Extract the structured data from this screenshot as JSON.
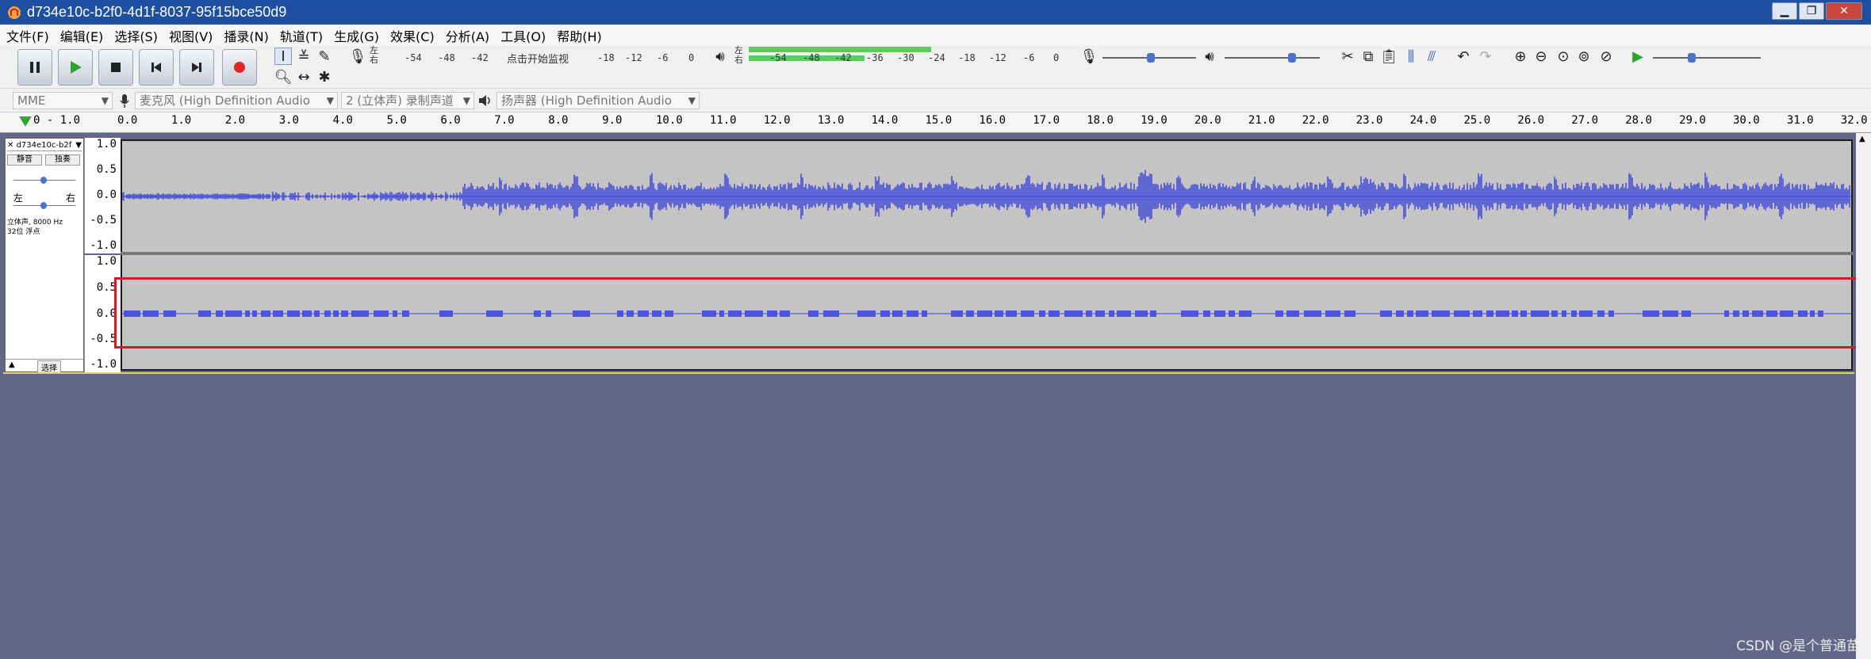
{
  "window": {
    "title": "d734e10c-b2f0-4d1f-8037-95f15bce50d9"
  },
  "menu": [
    "文件(F)",
    "编辑(E)",
    "选择(S)",
    "视图(V)",
    "播录(N)",
    "轨道(T)",
    "生成(G)",
    "效果(C)",
    "分析(A)",
    "工具(O)",
    "帮助(H)"
  ],
  "meters": {
    "record_lr": "左\n右",
    "record_ticks": [
      "-54",
      "-48",
      "-42"
    ],
    "record_hint": "点击开始监视",
    "record_ticks2": [
      "-18",
      "-12",
      "-6",
      "0"
    ],
    "play_lr": "左\n右",
    "play_ticks": [
      "-54",
      "-48",
      "-42",
      "-36",
      "-30",
      "-24",
      "-18",
      "-12",
      "-6",
      "0"
    ]
  },
  "devices": {
    "host": "MME",
    "mic": "麦克风 (High Definition Audio",
    "channels": "2 (立体声) 录制声道",
    "speaker": "扬声器 (High Definition Audio"
  },
  "ruler": {
    "first": "0 - 1.0",
    "ticks": [
      "0.0",
      "1.0",
      "2.0",
      "3.0",
      "4.0",
      "5.0",
      "6.0",
      "7.0",
      "8.0",
      "9.0",
      "10.0",
      "11.0",
      "12.0",
      "13.0",
      "14.0",
      "15.0",
      "16.0",
      "17.0",
      "18.0",
      "19.0",
      "20.0",
      "21.0",
      "22.0",
      "23.0",
      "24.0",
      "25.0",
      "26.0",
      "27.0",
      "28.0",
      "29.0",
      "30.0",
      "31.0",
      "32.0"
    ]
  },
  "track": {
    "name": "d734e10c-b2f",
    "mute": "静音",
    "solo": "独奏",
    "left": "左",
    "right": "右",
    "info_line1": "立体声, 8000 Hz",
    "info_line2": "32位 浮点",
    "select": "选择",
    "scale": [
      "1.0",
      "0.5",
      "0.0",
      "-0.5",
      "-1.0"
    ]
  },
  "watermark": "CSDN @是个普通苗"
}
